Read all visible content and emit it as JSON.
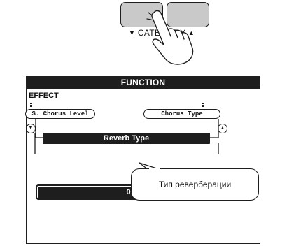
{
  "buttons": {
    "category_label": "CATEGORY",
    "down_arrow": "▼",
    "up_arrow": "▲"
  },
  "lcd": {
    "header": "FUNCTION",
    "section": "EFFECT",
    "left_tab": "S. Chorus Level",
    "right_tab": "Chorus Type",
    "selected_item": "Reverb Type",
    "value": "02(Hal",
    "left_button_icon": "scroll-down-icon",
    "right_button_icon": "scroll-up-icon"
  },
  "callout": {
    "text": "Тип реверберации"
  },
  "colors": {
    "button_fill": "#c9c9c9",
    "lcd_dark": "#1e1e1e",
    "background": "#ffffff"
  }
}
